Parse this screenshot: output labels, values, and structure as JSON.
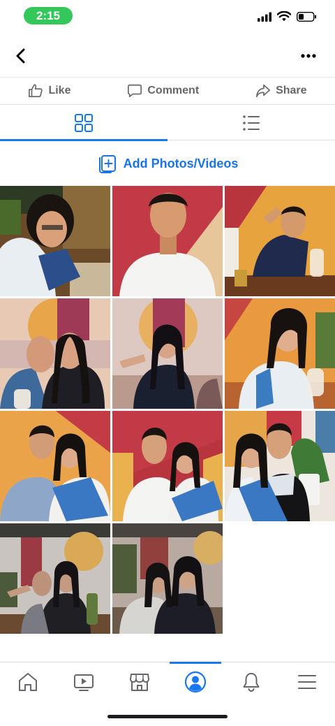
{
  "status_bar": {
    "time": "2:15",
    "icons": [
      "signal-icon",
      "wifi-icon",
      "battery-icon"
    ]
  },
  "header": {
    "back_icon": "chevron-left-icon",
    "more_icon": "more-horizontal-icon"
  },
  "actions": [
    {
      "label": "Like",
      "icon": "thumbs-up-icon"
    },
    {
      "label": "Comment",
      "icon": "comment-icon"
    },
    {
      "label": "Share",
      "icon": "share-icon"
    }
  ],
  "view_tabs": [
    {
      "icon": "grid-icon",
      "active": true
    },
    {
      "icon": "list-icon",
      "active": false
    }
  ],
  "add_photos": {
    "label": "Add Photos/Videos",
    "icon": "add-media-icon"
  },
  "photos": {
    "count": 11
  },
  "bottom_nav": [
    {
      "icon": "home-icon",
      "active": false
    },
    {
      "icon": "video-icon",
      "active": false
    },
    {
      "icon": "marketplace-icon",
      "active": false
    },
    {
      "icon": "profile-icon",
      "active": true
    },
    {
      "icon": "bell-icon",
      "active": false
    },
    {
      "icon": "menu-icon",
      "active": false
    }
  ],
  "colors": {
    "accent": "#1877f2",
    "link": "#1b74e4",
    "muted": "#65676b",
    "time_pill": "#34c759"
  }
}
